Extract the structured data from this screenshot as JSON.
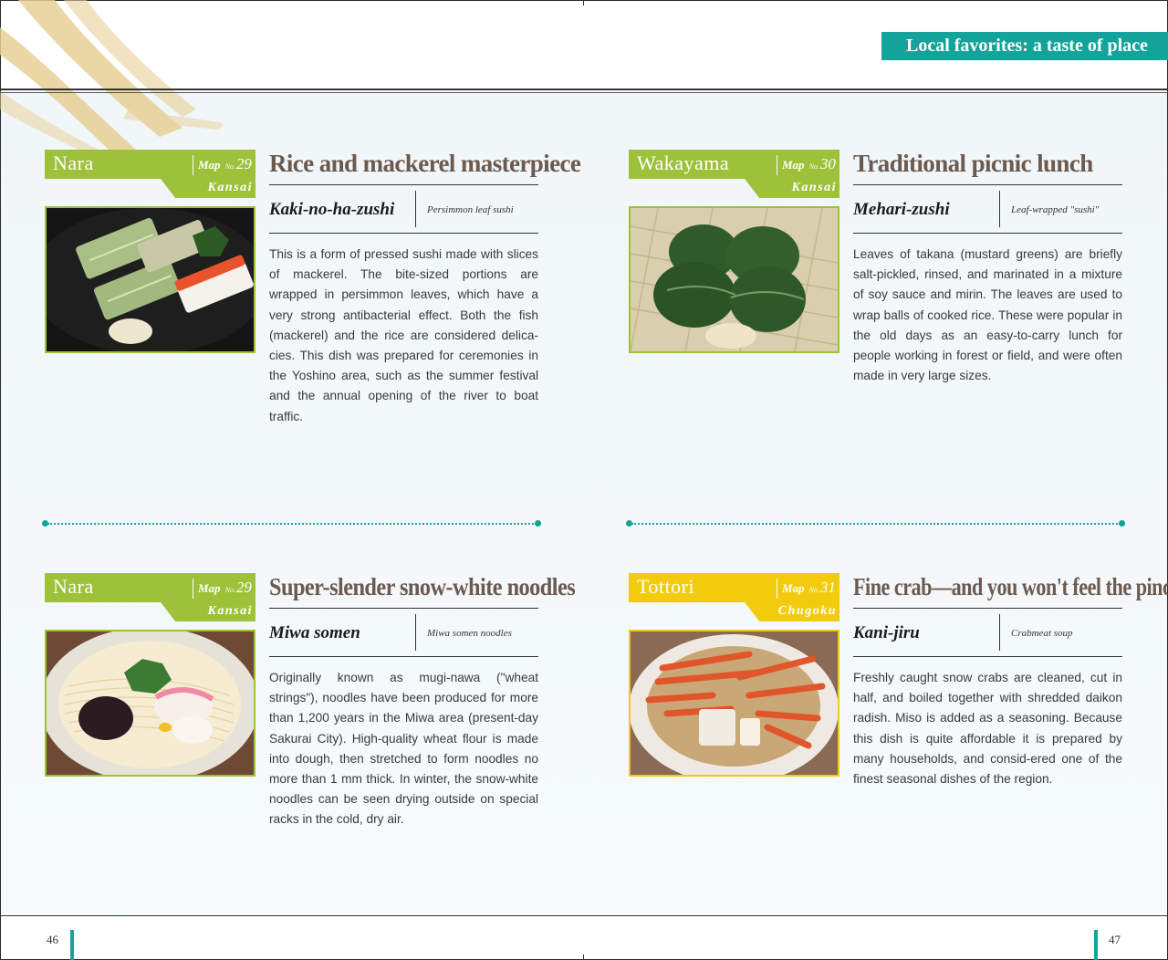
{
  "header": {
    "banner": "Local favorites: a taste of place"
  },
  "pages": {
    "left_number": "46",
    "right_number": "47"
  },
  "colors": {
    "teal": "#14a39a",
    "green_tag": "#9ec13a",
    "yellow_tag": "#f2cc0c",
    "title_brown": "#6b5a50"
  },
  "entries": [
    {
      "prefecture": "Nara",
      "map_word": "Map",
      "map_no": "No.",
      "map_number": "29",
      "region": "Kansai",
      "title": "Rice and mackerel masterpiece",
      "dish": "Kaki-no-ha-zushi",
      "dish_en": "Persimmon leaf sushi",
      "body": "This is a form of pressed sushi made with slices of mackerel. The bite-sized portions are wrapped in persimmon leaves, which have a very strong antibacterial effect. Both the fish (mackerel) and the rice are considered delica-cies. This dish was prepared for ceremonies in the Yoshino area, such as the summer festival and the annual opening of the river to boat traffic.",
      "tag_color": "green"
    },
    {
      "prefecture": "Wakayama",
      "map_word": "Map",
      "map_no": "No.",
      "map_number": "30",
      "region": "Kansai",
      "title": "Traditional picnic lunch",
      "dish": "Mehari-zushi",
      "dish_en": "Leaf-wrapped \"sushi\"",
      "body": "Leaves of takana (mustard greens) are briefly salt-pickled, rinsed, and marinated in a mixture of soy sauce and mirin. The leaves are used to wrap balls of cooked rice. These were popular in the old days as an easy-to-carry lunch for people working in forest or field, and were often made in very large sizes.",
      "tag_color": "green"
    },
    {
      "prefecture": "Nara",
      "map_word": "Map",
      "map_no": "No.",
      "map_number": "29",
      "region": "Kansai",
      "title": "Super-slender snow-white noodles",
      "dish": "Miwa somen",
      "dish_en": "Miwa somen noodles",
      "body": "Originally known as mugi-nawa (\"wheat strings\"), noodles have been produced for more than 1,200 years in the Miwa area (present-day Sakurai City). High-quality wheat flour is made into dough, then stretched to form noodles no more than 1 mm thick. In winter, the snow-white noodles can be seen drying outside on special racks in the cold, dry air.",
      "tag_color": "green"
    },
    {
      "prefecture": "Tottori",
      "map_word": "Map",
      "map_no": "No.",
      "map_number": "31",
      "region": "Chugoku",
      "title": "Fine crab—and you won't feel the pinch",
      "dish": "Kani-jiru",
      "dish_en": "Crabmeat soup",
      "body": "Freshly caught snow crabs are cleaned, cut in half, and boiled together with shredded daikon radish. Miso is added as a seasoning. Because this dish is quite affordable it is prepared by many households, and consid-ered one of the finest seasonal dishes of the region.",
      "tag_color": "yellow"
    }
  ]
}
